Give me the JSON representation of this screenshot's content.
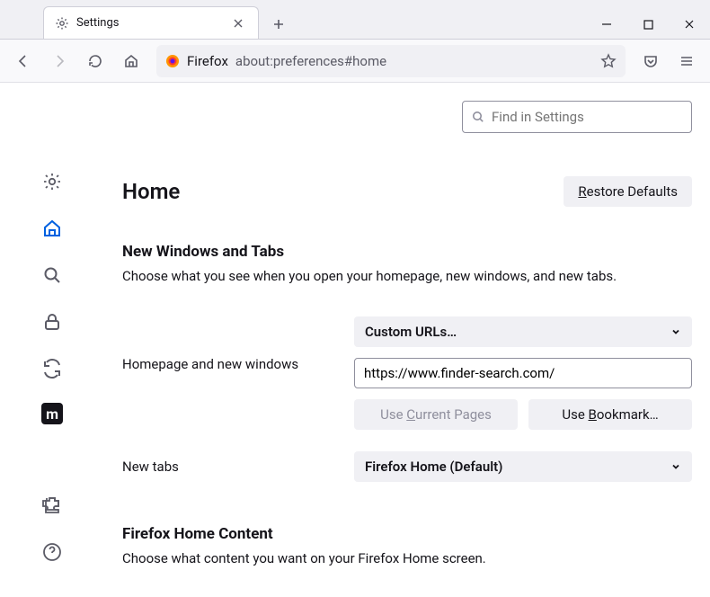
{
  "tab": {
    "title": "Settings"
  },
  "urlbar": {
    "prefix": "Firefox",
    "path": "about:preferences#home"
  },
  "search": {
    "placeholder": "Find in Settings"
  },
  "page": {
    "title": "Home",
    "restore_button": "Restore Defaults"
  },
  "section1": {
    "title": "New Windows and Tabs",
    "desc": "Choose what you see when you open your homepage, new windows, and new tabs."
  },
  "homepage": {
    "label": "Homepage and new windows",
    "dropdown": "Custom URLs…",
    "url_value": "https://www.finder-search.com/",
    "use_current": "Use Current Pages",
    "use_bookmark": "Use Bookmark…"
  },
  "newtabs": {
    "label": "New tabs",
    "dropdown": "Firefox Home (Default)"
  },
  "section2": {
    "title": "Firefox Home Content",
    "desc": "Choose what content you want on your Firefox Home screen."
  }
}
